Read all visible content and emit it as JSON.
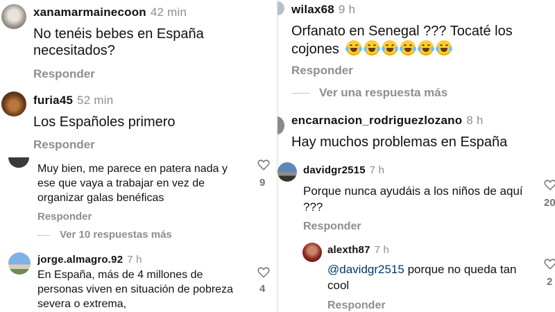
{
  "reply_label": "Responder",
  "left": {
    "comments": [
      {
        "user": "xanamarmainecoon",
        "time": "42 min",
        "text": "No tenéis bebes en España necesitados?",
        "reply": "Responder"
      },
      {
        "user": "furia45",
        "time": "52 min",
        "text": "Los Españoles primero",
        "reply": "Responder"
      },
      {
        "user": "",
        "time": "",
        "text": "Muy bien, me parece en patera nada y ese que vaya a trabajar en vez de organizar galas benéficas",
        "reply": "Responder",
        "likes": "9",
        "more": "Ver 10 respuestas más"
      },
      {
        "user": "jorge.almagro.92",
        "time": "7 h",
        "text": "En España, más de 4 millones de personas viven en situación de pobreza severa o extrema,",
        "likes": "4"
      }
    ]
  },
  "right": {
    "comments": [
      {
        "user": "wilax68",
        "time": "9 h",
        "text": "Orfanato en Senegal ??? Tocaté los cojones",
        "reply": "Responder",
        "more": "Ver una respuesta más"
      },
      {
        "user": "encarnacion_rodriguezlozano",
        "time": "8 h",
        "text": "Hay muchos problemas en España"
      },
      {
        "user": "davidgr2515",
        "time": "7 h",
        "text": "Porque nunca ayudáis a los niños de aquí ???",
        "reply": "Responder",
        "likes": "20"
      },
      {
        "user": "alexth87",
        "time": "7 h",
        "mention": "@davidgr2515",
        "text": " porque no queda tan cool",
        "reply": "Responder",
        "likes": "2"
      }
    ]
  },
  "colors": {
    "secondary": "#8e8e8e",
    "mention": "#00376b",
    "text": "#111111"
  },
  "icons": {
    "like": "heart-outline-icon",
    "laugh": "face-with-tears-of-joy-emoji"
  }
}
